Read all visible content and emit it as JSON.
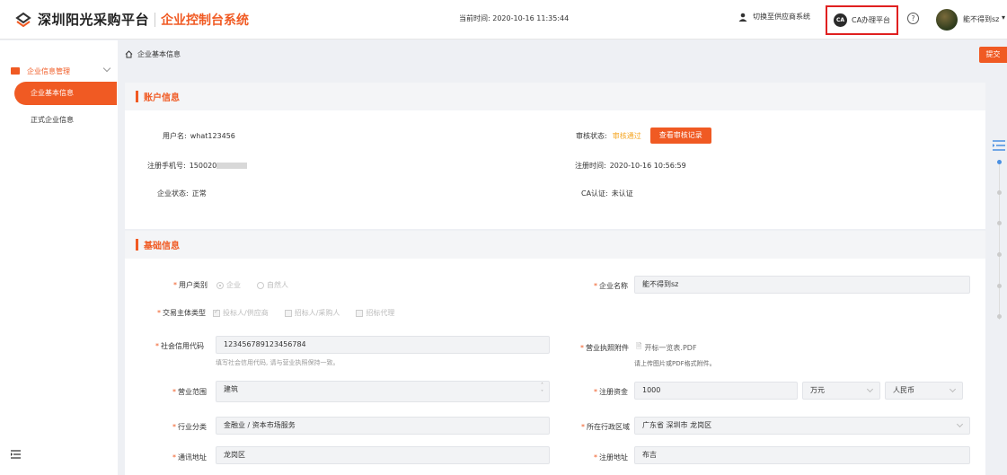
{
  "header": {
    "brand": "深圳阳光采购平台",
    "system_name": "企业控制台系统",
    "time_label": "当前时间: 2020-10-16 11:35:44",
    "switch_label": "切换至供应商系统",
    "ca_icon_text": "CA",
    "ca_label": "CA办理平台",
    "help_label": "?",
    "username": "能不得到sz"
  },
  "sidebar": {
    "group_label": "企业信息管理",
    "items": [
      {
        "label": "企业基本信息",
        "active": true
      },
      {
        "label": "正式企业信息",
        "active": false
      }
    ]
  },
  "breadcrumb": "企业基本信息",
  "submit_label": "提交",
  "account": {
    "title": "账户信息",
    "username_label": "用户名:",
    "username": "what123456",
    "phone_label": "注册手机号:",
    "phone_prefix": "150020",
    "status_label": "企业状态:",
    "status": "正常",
    "audit_label": "审核状态:",
    "audit_status": "审核通过",
    "audit_button": "查看审核记录",
    "reg_time_label": "注册时间:",
    "reg_time": "2020-10-16 10:56:59",
    "ca_label": "CA认证:",
    "ca_status": "未认证"
  },
  "basic": {
    "title": "基础信息",
    "user_type_label": "用户类别",
    "user_type_options": [
      "企业",
      "自然人"
    ],
    "trade_type_label": "交易主体类型",
    "trade_type_options": [
      "投标人/供应商",
      "招标人/采购人",
      "招标代理"
    ],
    "credit_code_label": "社会信用代码",
    "credit_code": "123456789123456784",
    "credit_code_hint": "填写社会信用代码, 请与营业执照保持一致。",
    "scope_label": "营业范围",
    "scope": "建筑",
    "industry_label": "行业分类",
    "industry": "金融业 / 资本市场服务",
    "address_label": "通讯地址",
    "address": "龙岗区",
    "company_name_label": "企业名称",
    "company_name": "能不得到sz",
    "license_label": "营业执照附件",
    "license_file": "开标一览表.PDF",
    "license_hint": "请上传图片或PDF格式附件。",
    "capital_label": "注册资金",
    "capital": "1000",
    "capital_unit": "万元",
    "capital_currency": "人民币",
    "region_label": "所在行政区域",
    "region": "广东省 深圳市 龙岗区",
    "reg_address_label": "注册地址",
    "reg_address": "布吉"
  },
  "colors": {
    "accent": "#f05a23",
    "highlight_border": "#e02020"
  }
}
